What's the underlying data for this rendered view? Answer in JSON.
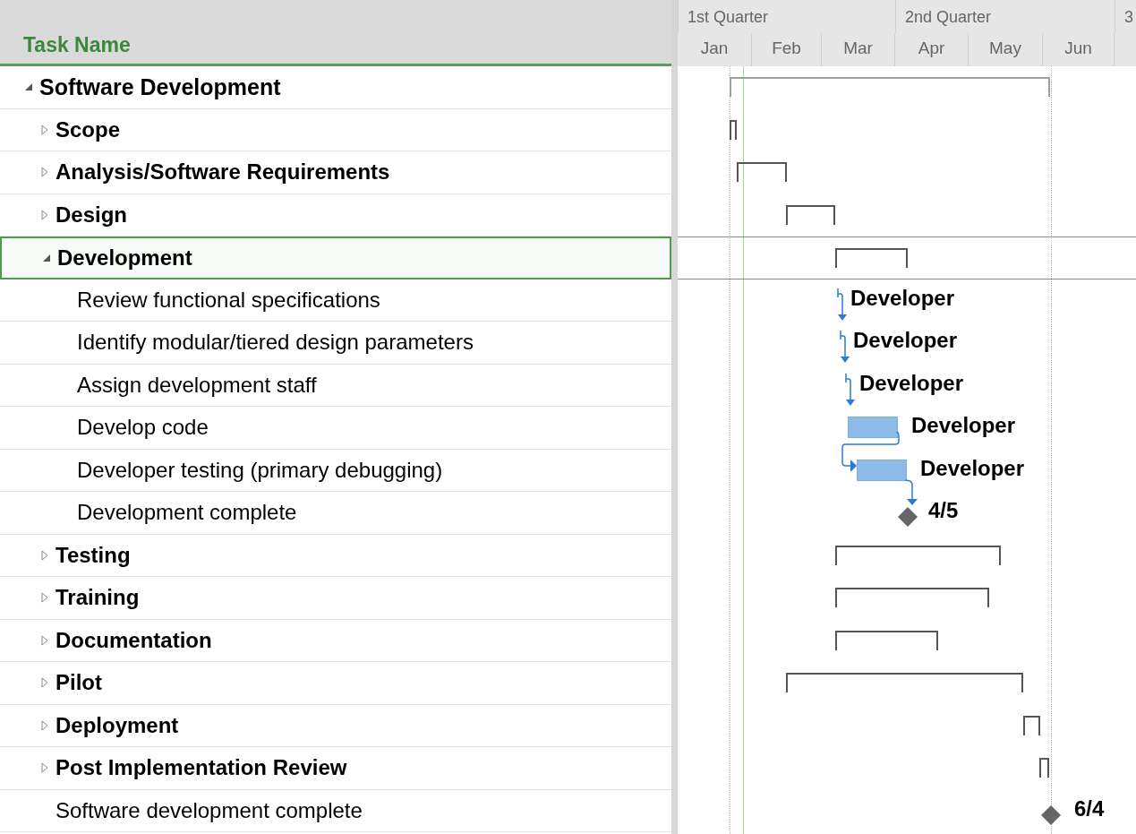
{
  "header": {
    "task_column": "Task Name",
    "quarters": [
      "1st Quarter",
      "2nd Quarter",
      "3"
    ],
    "months": [
      "Jan",
      "Feb",
      "Mar",
      "Apr",
      "May",
      "Jun"
    ]
  },
  "tasks": [
    {
      "name": "Software Development",
      "kind": "summary",
      "expanded": true,
      "selected": false,
      "children": [
        {
          "name": "Scope",
          "kind": "summary",
          "expanded": false,
          "selected": false
        },
        {
          "name": "Analysis/Software Requirements",
          "kind": "summary",
          "expanded": false,
          "selected": false
        },
        {
          "name": "Design",
          "kind": "summary",
          "expanded": false,
          "selected": false
        },
        {
          "name": "Development",
          "kind": "summary",
          "expanded": true,
          "selected": true,
          "children": [
            {
              "name": "Review functional specifications",
              "kind": "link",
              "selected": false,
              "bar_label": "Developer"
            },
            {
              "name": "Identify modular/tiered design parameters",
              "kind": "link",
              "selected": false,
              "bar_label": "Developer"
            },
            {
              "name": "Assign development staff",
              "kind": "link",
              "selected": false,
              "bar_label": "Developer"
            },
            {
              "name": "Develop code",
              "kind": "task",
              "selected": false,
              "bar_label": "Developer"
            },
            {
              "name": "Developer testing (primary debugging)",
              "kind": "task",
              "selected": false,
              "bar_label": "Developer"
            },
            {
              "name": "Development complete",
              "kind": "milestone",
              "selected": false,
              "bar_label": "4/5"
            }
          ]
        },
        {
          "name": "Testing",
          "kind": "summary",
          "expanded": false,
          "selected": false
        },
        {
          "name": "Training",
          "kind": "summary",
          "expanded": false,
          "selected": false
        },
        {
          "name": "Documentation",
          "kind": "summary",
          "expanded": false,
          "selected": false
        },
        {
          "name": "Pilot",
          "kind": "summary",
          "expanded": false,
          "selected": false
        },
        {
          "name": "Deployment",
          "kind": "summary",
          "expanded": false,
          "selected": false
        },
        {
          "name": "Post Implementation Review",
          "kind": "summary",
          "expanded": false,
          "selected": false
        },
        {
          "name": "Software development complete",
          "kind": "milestone",
          "selected": false,
          "bar_label": "6/4"
        }
      ]
    }
  ]
}
